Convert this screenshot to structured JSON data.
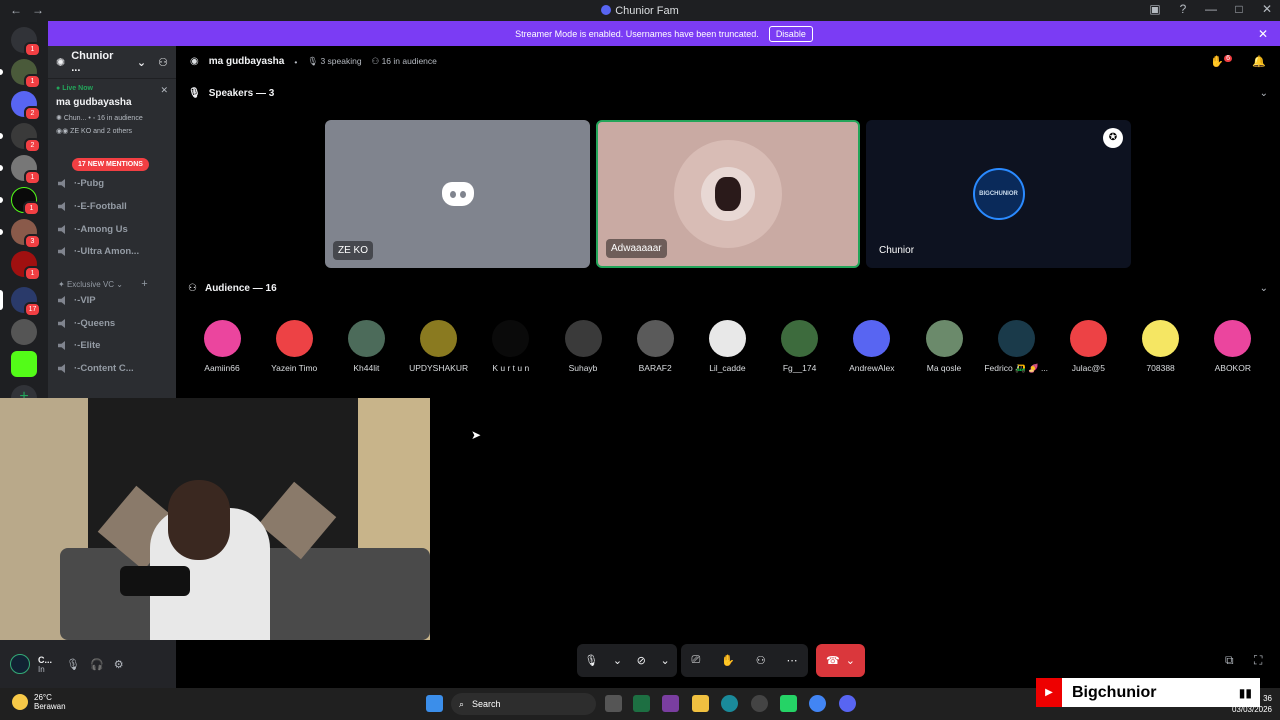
{
  "window": {
    "title": "Chunior Fam"
  },
  "banner": {
    "text": "Streamer Mode is enabled. Usernames have been truncated.",
    "button": "Disable"
  },
  "rail": {
    "badges": [
      "1",
      "1",
      "2",
      "2",
      "1",
      "1",
      "3",
      "1",
      "17"
    ]
  },
  "sidebar": {
    "server_name": "Chunior ...",
    "live_label": "Live Now",
    "live_name": "ma gudbayasha",
    "live_channel": "Chun...",
    "live_audience": "• ◦ 16 in audience",
    "live_users": "ZE KO and 2 others",
    "mentions": "17 NEW MENTIONS",
    "channels": [
      "·-Pubg",
      "·-E-Football",
      "·-Among Us",
      "·-Ultra Amon..."
    ],
    "category": "Exclusive VC",
    "vip_channels": [
      "·-VIP",
      "·-Queens",
      "·-Elite",
      "·-Content C..."
    ]
  },
  "user_panel": {
    "name": "C...",
    "status": "In"
  },
  "stage": {
    "title": "ma gudbayasha",
    "speaking": "3 speaking",
    "audience": "16 in audience",
    "speakers_header": "Speakers — 3",
    "audience_header": "Audience — 16",
    "hand_count": "6"
  },
  "speakers": [
    {
      "name": "ZE KO",
      "color": "#80848e"
    },
    {
      "name": "Adwaaaaar",
      "color": "#c9aaa3"
    },
    {
      "name": "Chunior",
      "color": "#0d1220",
      "avatar_text": "BIGCHUNIOR"
    }
  ],
  "audience": [
    {
      "name": "Aamiin66",
      "color": "#eb459e"
    },
    {
      "name": "Yazein Timo",
      "color": "#ed4245"
    },
    {
      "name": "Kh44lit",
      "color": "#4c6b5a"
    },
    {
      "name": "UPDYSHAKUR",
      "color": "#8a7a20"
    },
    {
      "name": "K u r t u n",
      "color": "#0a0a0a"
    },
    {
      "name": "Suhayb",
      "color": "#3a3a3a"
    },
    {
      "name": "BARAF2",
      "color": "#5a5a5a"
    },
    {
      "name": "Lil_cadde",
      "color": "#e8e8e8"
    },
    {
      "name": "Fg__174",
      "color": "#3d6b3d"
    },
    {
      "name": "AndrewAlex",
      "color": "#5865f2"
    },
    {
      "name": "Ma qosle",
      "color": "#6b8a6b"
    },
    {
      "name": "Fedrico 🛺 🍠 ...",
      "color": "#1a3a4a"
    },
    {
      "name": "Julac@5",
      "color": "#ed4245"
    },
    {
      "name": "708388",
      "color": "#f5e663"
    },
    {
      "name": "ABOKOR",
      "color": "#eb459e"
    }
  ],
  "taskbar": {
    "temp": "26°C",
    "weather": "Berawan",
    "search": "Search",
    "time": "36",
    "date": "03/03/2026"
  },
  "overlay": {
    "channel": "Bigchunior"
  }
}
